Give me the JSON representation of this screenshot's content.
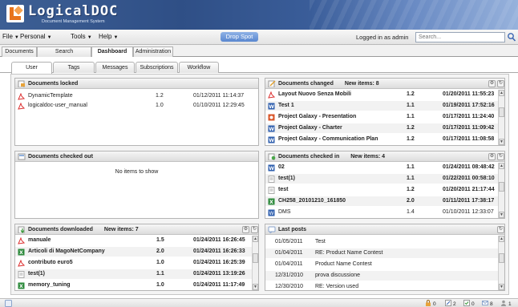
{
  "brand": {
    "name": "LogicalDOC",
    "tagline": "Document Management System",
    "accent": "#e8741c"
  },
  "menubar": {
    "menus": [
      {
        "label": "File"
      },
      {
        "label": "Personal"
      },
      {
        "label": "Tools"
      },
      {
        "label": "Help"
      }
    ],
    "drop_spot": "Drop Spot",
    "logged_in": "Logged in as admin",
    "search_placeholder": "Search..."
  },
  "main_tabs": [
    "Documents",
    "Search",
    "Dashboard",
    "Administration"
  ],
  "active_main_tab": "Dashboard",
  "sub_tabs": [
    "User",
    "Tags",
    "Messages",
    "Subscriptions",
    "Workflow"
  ],
  "active_sub_tab": "User",
  "portlets": {
    "locked": {
      "title": "Documents locked",
      "rows": [
        {
          "icon": "pdf-icon",
          "name": "DynamicTemplate",
          "version": "1.2",
          "date": "01/12/2011 11:14:37"
        },
        {
          "icon": "pdf-icon",
          "name": "logicaldoc-user_manual",
          "version": "1.0",
          "date": "01/10/2011 12:29:45"
        }
      ]
    },
    "changed": {
      "title": "Documents changed",
      "new_items": "New items: 8",
      "rows": [
        {
          "icon": "pdf-icon",
          "name": "Layout Nuovo Senza Mobili",
          "version": "1.2",
          "date": "01/20/2011 11:55:23"
        },
        {
          "icon": "word-icon",
          "name": "Test 1",
          "version": "1.1",
          "date": "01/19/2011 17:52:16"
        },
        {
          "icon": "presentation-icon",
          "name": "Project Galaxy - Presentation",
          "version": "1.1",
          "date": "01/17/2011 11:24:40"
        },
        {
          "icon": "word-icon",
          "name": "Project Galaxy - Charter",
          "version": "1.2",
          "date": "01/17/2011 11:09:42"
        },
        {
          "icon": "word-icon",
          "name": "Project Galaxy - Communication Plan",
          "version": "1.2",
          "date": "01/17/2011 11:08:58"
        }
      ]
    },
    "checked_out": {
      "title": "Documents checked out",
      "empty": "No items to show"
    },
    "checked_in": {
      "title": "Documents checked in",
      "new_items": "New items: 4",
      "rows": [
        {
          "icon": "word-icon",
          "name": "02",
          "version": "1.1",
          "date": "01/24/2011 08:48:42",
          "bold": true
        },
        {
          "icon": "text-icon",
          "name": "test(1)",
          "version": "1.1",
          "date": "01/22/2011 00:58:10",
          "bold": true
        },
        {
          "icon": "text-icon",
          "name": "test",
          "version": "1.2",
          "date": "01/20/2011 21:17:44",
          "bold": true
        },
        {
          "icon": "spreadsheet-icon",
          "name": "CH258_20101210_161850",
          "version": "2.0",
          "date": "01/11/2011 17:38:17",
          "bold": true
        },
        {
          "icon": "word-icon",
          "name": "DMS",
          "version": "1.4",
          "date": "01/10/2011 12:33:07",
          "bold": false
        }
      ]
    },
    "downloaded": {
      "title": "Documents downloaded",
      "new_items": "New items: 7",
      "rows": [
        {
          "icon": "pdf-icon",
          "name": "manuale",
          "version": "1.5",
          "date": "01/24/2011 16:26:45"
        },
        {
          "icon": "spreadsheet-icon",
          "name": "Articoli di MagoNetCompany",
          "version": "2.0",
          "date": "01/24/2011 16:26:33"
        },
        {
          "icon": "pdf-icon",
          "name": "contributo euro5",
          "version": "1.0",
          "date": "01/24/2011 16:25:39"
        },
        {
          "icon": "text-icon",
          "name": "test(1)",
          "version": "1.1",
          "date": "01/24/2011 13:19:26"
        },
        {
          "icon": "spreadsheet-icon",
          "name": "memory_tuning",
          "version": "1.0",
          "date": "01/24/2011 11:17:49"
        }
      ]
    },
    "last_posts": {
      "title": "Last posts",
      "rows": [
        {
          "date": "01/05/2011",
          "subject": "Test"
        },
        {
          "date": "01/04/2011",
          "subject": "RE: Product Name Contest"
        },
        {
          "date": "01/04/2011",
          "subject": "Product Name Contest"
        },
        {
          "date": "12/31/2010",
          "subject": "prova discussione"
        },
        {
          "date": "12/30/2010",
          "subject": "RE: Version used"
        }
      ]
    }
  },
  "statusbar": {
    "locked_count": "0",
    "checked_out_count": "2",
    "tasks_count": "0",
    "messages_count": "8",
    "users_count": "1"
  }
}
